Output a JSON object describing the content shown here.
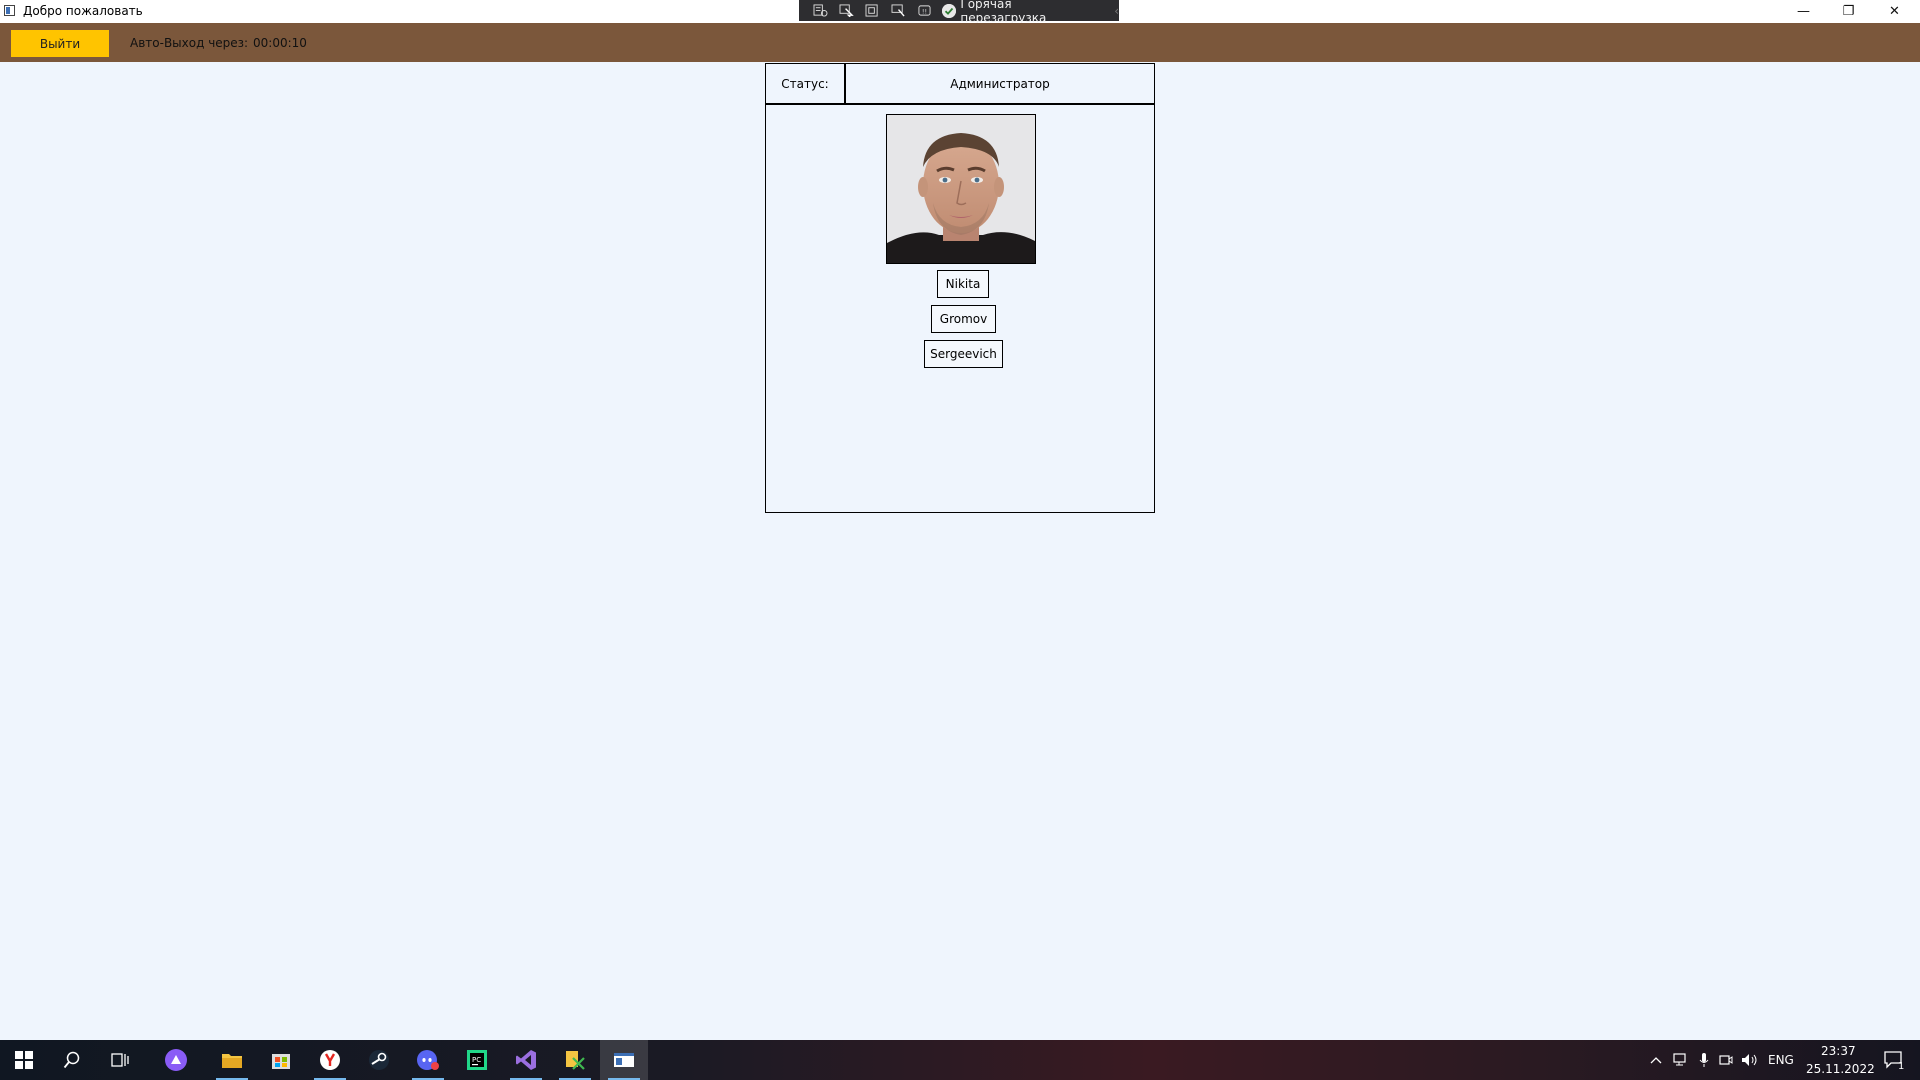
{
  "window": {
    "title": "Добро пожаловать",
    "controls": {
      "minimize": "—",
      "restore": "❐",
      "close": "✕"
    }
  },
  "debug_toolbar": {
    "hot_reload_label": "Горячая перезагрузка",
    "collapse_glyph": "‹",
    "icons": [
      "live-visual-tree-icon",
      "select-element-icon",
      "display-layout-adorners-icon",
      "track-focus-icon",
      "xaml-binding-failures-icon",
      "hot-reload-ok-icon"
    ]
  },
  "topbar": {
    "logout_label": "Выйти",
    "autologout_label": "Авто-Выход через:",
    "autologout_value": "00:00:10",
    "colors": {
      "background": "#7b573b",
      "button": "#ffc400"
    }
  },
  "profile": {
    "status_label": "Статус:",
    "status_value": "Администратор",
    "first_name": "Nikita",
    "last_name": "Gromov",
    "patronymic": "Sergeevich"
  },
  "taskbar": {
    "apps": [
      "windows-start-icon",
      "search-icon",
      "task-view-icon",
      "alice-icon",
      "file-explorer-icon",
      "store-icon",
      "yandex-browser-icon",
      "steam-icon",
      "discord-icon",
      "pycharm-icon",
      "visual-studio-icon",
      "xaml-designer-icon",
      "app-window-icon"
    ],
    "language": "ENG",
    "time": "23:37",
    "date": "25.11.2022",
    "notification_count": "1"
  }
}
